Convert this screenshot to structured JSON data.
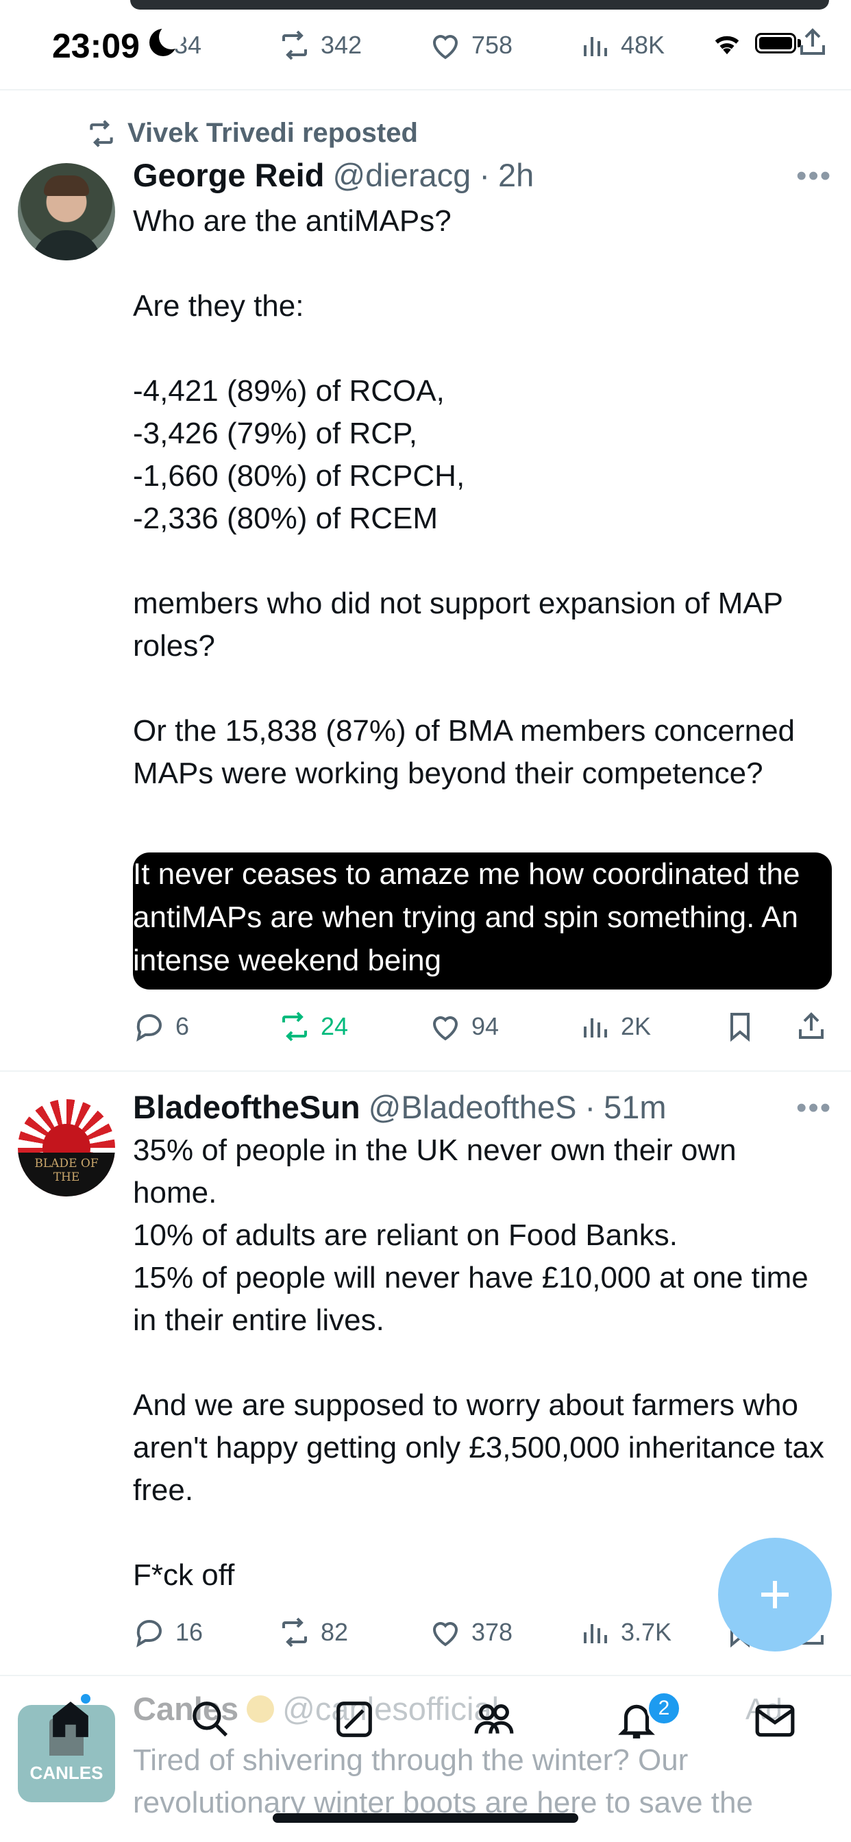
{
  "status_bar": {
    "time": "23:09"
  },
  "top_post_actions": {
    "replies": "34",
    "reposts": "342",
    "likes": "758",
    "views": "48K"
  },
  "post1": {
    "repost_label": "Vivek Trivedi reposted",
    "author_name": "George Reid",
    "author_handle": "@dieracg",
    "separator": "·",
    "time": "2h",
    "text": "Who are the antiMAPs?\n\nAre they the:\n\n-4,421 (89%) of RCOA,\n-3,426 (79%) of RCP,\n-1,660 (80%) of RCPCH,\n-2,336 (80%) of RCEM\n\nmembers who did not support expansion of MAP roles?\n\nOr the 15,838 (87%) of BMA members concerned MAPs were working beyond their competence?",
    "quoted_text": "It never ceases to amaze me how coordinated the antiMAPs are when trying and spin something. An intense weekend being",
    "replies": "6",
    "reposts": "24",
    "likes": "94",
    "views": "2K"
  },
  "post2": {
    "author_name": "BladeoftheSun",
    "author_handle": "@BladeoftheS",
    "separator": "·",
    "time": "51m",
    "avatar_text": "BLADE OF THE",
    "text": "35% of people in the UK never own their own home.\n10% of adults are reliant on Food Banks.\n15% of people will never have £10,000 at one time in their entire lives.\n\nAnd we are supposed to worry about farmers who aren't happy getting only £3,500,000 inheritance tax free.\n\nF*ck off",
    "replies": "16",
    "reposts": "82",
    "likes": "378",
    "views": "3.7K"
  },
  "post3": {
    "author_name": "Canles",
    "author_handle": "@canlesofficial",
    "ad_label": "Ad",
    "avatar_text": "CANLES",
    "text": "Tired of shivering through the winter? Our revolutionary winter boots are here to save the"
  },
  "nav": {
    "notification_count": "2"
  },
  "colors": {
    "accent": "#1d9bf0",
    "repost_green": "#00ba7c",
    "muted": "#536471",
    "fab": "#8ecdf8"
  }
}
